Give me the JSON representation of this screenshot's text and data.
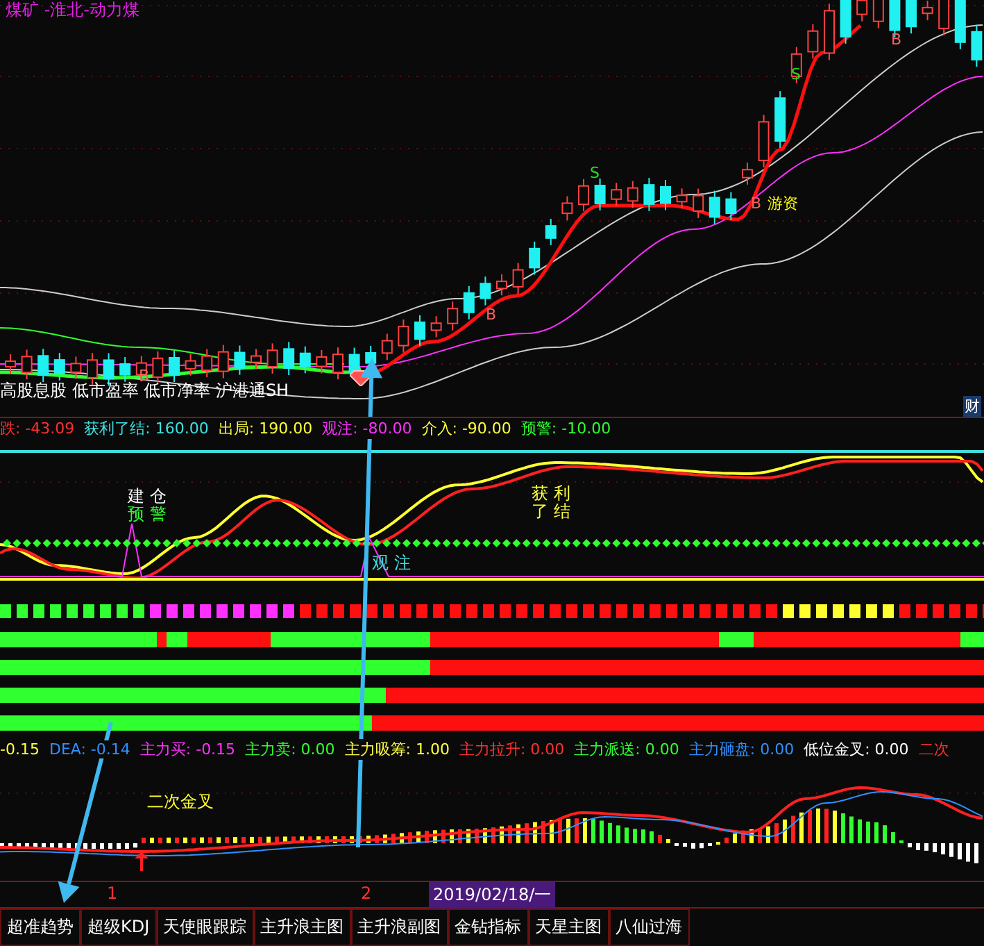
{
  "window": {
    "title": "煤矿 -淮北-动力煤"
  },
  "main_chart": {
    "markers": [
      {
        "text": "B",
        "color": "#ff6060"
      },
      {
        "text": "B",
        "color": "#ff6060"
      },
      {
        "text": "S",
        "color": "#22dd22"
      },
      {
        "text": "B",
        "color": "#ff6060"
      },
      {
        "text": "游资",
        "color": "#ffff00"
      },
      {
        "text": "S",
        "color": "#22dd22"
      },
      {
        "text": "B",
        "color": "#ff6060"
      }
    ],
    "tags": "高股息股 低市盈率 低市净率 沪港通SH",
    "corner_badge": "财"
  },
  "oscillator": {
    "readouts": [
      {
        "text": "跌: -43.09",
        "color": "#ff3030"
      },
      {
        "text": "获利了结: 160.00",
        "color": "#40e0e0"
      },
      {
        "text": "出局: 190.00",
        "color": "#ffff40"
      },
      {
        "text": "观注: -80.00",
        "color": "#ff30ff"
      },
      {
        "text": "介入: -90.00",
        "color": "#ffff40"
      },
      {
        "text": "预警: -10.00",
        "color": "#30ff30"
      }
    ],
    "signals": [
      {
        "text": "建 仓",
        "color": "#ffffff"
      },
      {
        "text": "预 警",
        "color": "#30ff30"
      },
      {
        "text": "获 利",
        "color": "#ffff40"
      },
      {
        "text": "了 结",
        "color": "#ffff40"
      },
      {
        "text": "观 注",
        "color": "#40e0e0"
      }
    ]
  },
  "macd": {
    "readouts": [
      {
        "text": "-0.15",
        "color": "#ffff40"
      },
      {
        "text": "DEA: -0.14",
        "color": "#3090ff"
      },
      {
        "text": "主力买: -0.15",
        "color": "#ff30ff"
      },
      {
        "text": "主力卖: 0.00",
        "color": "#30ff30"
      },
      {
        "text": "主力吸筹: 1.00",
        "color": "#ffff40"
      },
      {
        "text": "主力拉升: 0.00",
        "color": "#ff3030"
      },
      {
        "text": "主力派送: 0.00",
        "color": "#30ff30"
      },
      {
        "text": "主力砸盘: 0.00",
        "color": "#3090ff"
      },
      {
        "text": "低位金叉: 0.00",
        "color": "#ffffff"
      },
      {
        "text": "二次",
        "color": "#ff3030"
      }
    ],
    "signal": "二次金叉"
  },
  "time_axis": {
    "marks": [
      "1",
      "2"
    ],
    "cursor_date": "2019/02/18/一"
  },
  "tabs": [
    {
      "label": "超准趋势"
    },
    {
      "label": "超级KDJ"
    },
    {
      "label": "天使眼跟踪"
    },
    {
      "label": "主升浪主图"
    },
    {
      "label": "主升浪副图"
    },
    {
      "label": "金钻指标"
    },
    {
      "label": "天星主图"
    },
    {
      "label": "八仙过海"
    }
  ]
}
